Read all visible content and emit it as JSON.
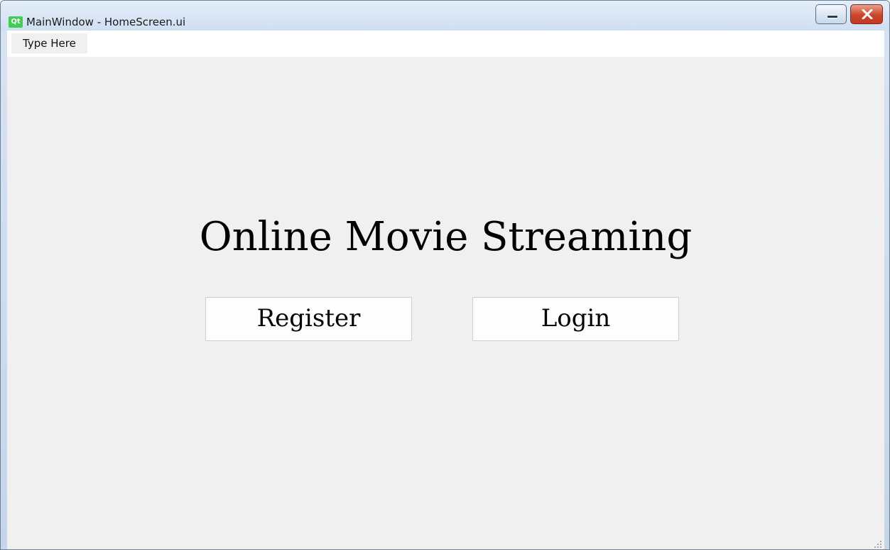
{
  "window": {
    "title": "MainWindow - HomeScreen.ui",
    "app_icon_text": "Qt",
    "app_icon_color": "#41cd52"
  },
  "menubar": {
    "items": [
      {
        "label": "Type Here"
      }
    ]
  },
  "main": {
    "headline": "Online Movie Streaming",
    "register_label": "Register",
    "login_label": "Login"
  },
  "colors": {
    "client_background": "#f0f0f0",
    "close_button": "#c9452a"
  }
}
